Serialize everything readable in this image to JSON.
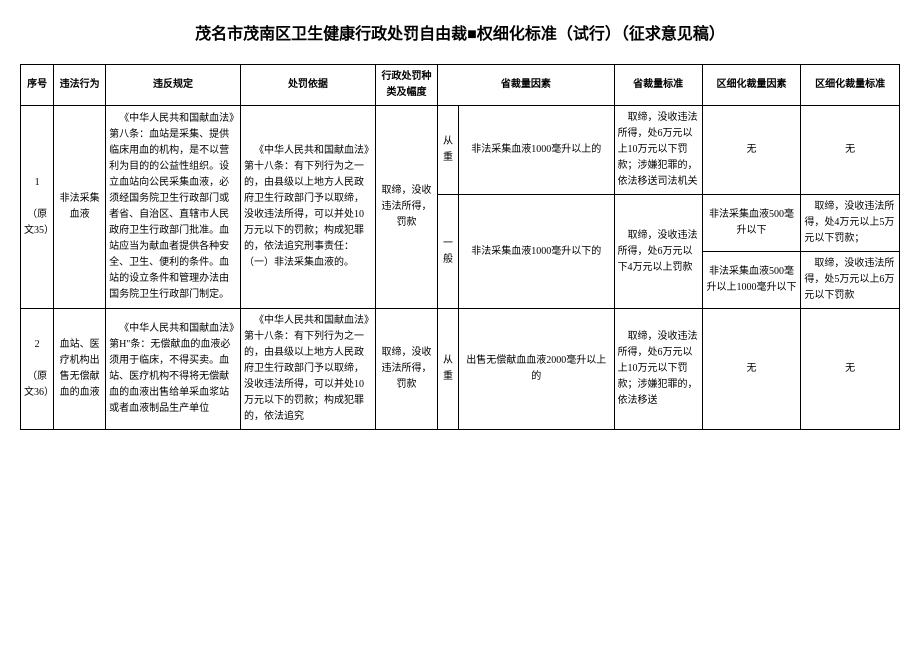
{
  "title": "茂名市茂南区卫生健康行政处罚自由裁■权细化标准（试行）（征求意见稿）",
  "headers": {
    "seq": "序号",
    "act": "违法行为",
    "rule": "违反规定",
    "basis": "处罚依据",
    "type": "行政处罚种类及幅度",
    "factor": "省裁量因素",
    "standard": "省裁量标准",
    "detail_factor": "区细化裁量因素",
    "detail_std": "区细化裁量标准"
  },
  "rows": [
    {
      "seq_num": "1",
      "seq_ref": "（原文35）",
      "act": "非法采集血液",
      "rule": "《中华人民共和国献血法》第八条：血站是采集、提供临床用血的机构，是不以营利为目的的公益性组织。设立血站向公民采集血液，必须经国务院卫生行政部门或者省、自治区、直辖市人民政府卫生行政部门批准。血站应当为献血者提供各种安全、卫生、便利的条件。血站的设立条件和管理办法由国务院卫生行政部门制定。",
      "basis": "《中华人民共和国献血法》第十八条：有下列行为之一的，由县级以上地方人民政府卫生行政部门予以取缔，没收违法所得，可以并处10万元以下的罚款；构成犯罪的，依法追究刑事责任：（一）非法采集血液的。",
      "type": "取缔，没收违法所得，罚款",
      "levels": [
        {
          "level": "从重",
          "factor": "非法采集血液1000毫升以上的",
          "standard": "取缔，没收违法所得，处6万元以上10万元以下罚款；涉嫌犯罪的，依法移送司法机关",
          "detail_factor": "无",
          "detail_std": "无"
        },
        {
          "level": "一般",
          "factor": "非法采集血液1000毫升以下的",
          "standard": "取缔，没收违法所得，处6万元以下4万元以上罚款",
          "details": [
            {
              "detail_factor": "非法采集血液500毫升以下",
              "detail_std": "取缔，没收违法所得，处4万元以上5万元以下罚款；"
            },
            {
              "detail_factor": "非法采集血液500毫升以上1000毫升以下",
              "detail_std": "取缔，没收违法所得，处5万元以上6万元以下罚款"
            }
          ]
        }
      ]
    },
    {
      "seq_num": "2",
      "seq_ref": "（原文36）",
      "act": "血站、医疗机构出售无偿献血的血液",
      "rule": "《中华人民共和国献血法》第H\"条：无偿献血的血液必须用于临床，不得买卖。血站、医疗机构不得将无偿献血的血液出售给单采血浆站或者血液制品生产单位",
      "basis": "《中华人民共和国献血法》第十八条：有下列行为之一的，由县级以上地方人民政府卫生行政部门予以取缔，没收违法所得，可以并处10万元以下的罚款；构成犯罪的，依法追究",
      "type": "取缔，没收违法所得，罚款",
      "levels": [
        {
          "level": "从重",
          "factor": "出售无偿献血血液2000毫升以上的",
          "standard": "取缔，没收违法所得，处6万元以上10万元以下罚款；涉嫌犯罪的，依法移送",
          "detail_factor": "无",
          "detail_std": "无"
        }
      ]
    }
  ]
}
